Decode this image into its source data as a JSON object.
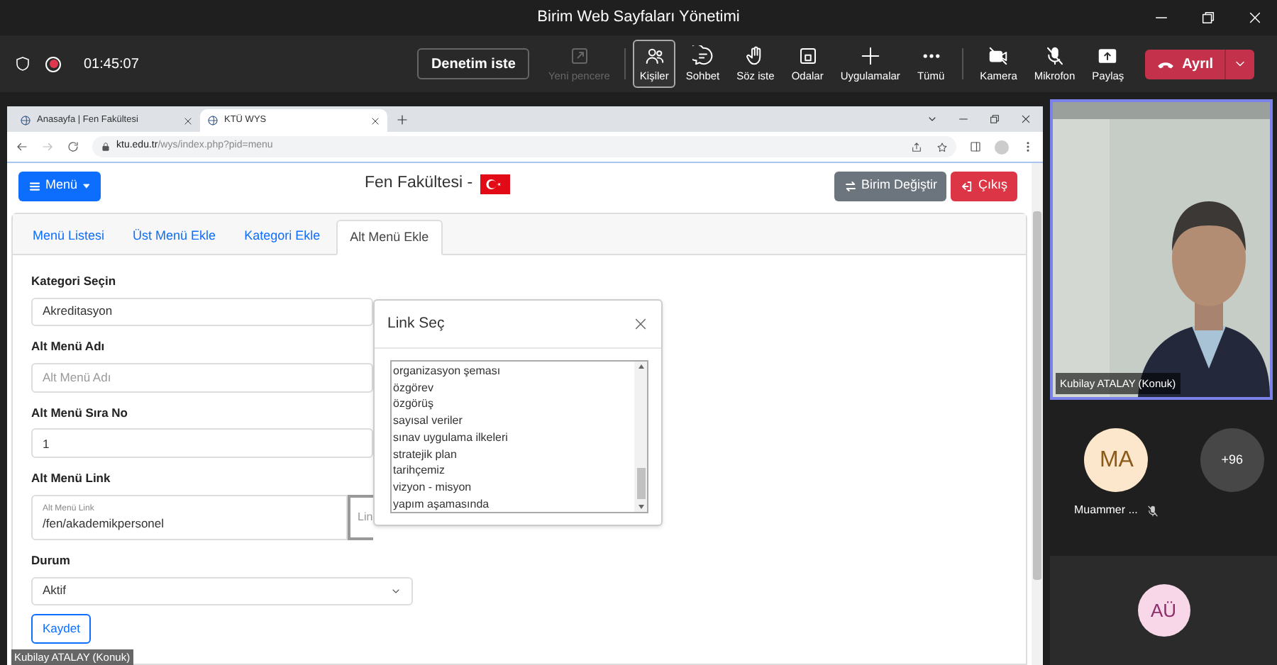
{
  "window": {
    "title": "Birim Web Sayfaları Yönetimi"
  },
  "meeting_bar": {
    "timer": "01:45:07",
    "request_button": "Denetim iste",
    "tools": [
      {
        "kind": "new-window",
        "label": "Yeni pencere",
        "disabled": true,
        "selected": false
      },
      {
        "kind": "people",
        "label": "Kişiler",
        "disabled": false,
        "selected": true
      },
      {
        "kind": "chat",
        "label": "Sohbet",
        "disabled": false,
        "selected": false
      },
      {
        "kind": "hand",
        "label": "Söz iste",
        "disabled": false,
        "selected": false
      },
      {
        "kind": "rooms",
        "label": "Odalar",
        "disabled": false,
        "selected": false
      },
      {
        "kind": "plus",
        "label": "Uygulamalar",
        "disabled": false,
        "selected": false
      },
      {
        "kind": "more",
        "label": "Tümü",
        "disabled": false,
        "selected": false
      }
    ],
    "devices": [
      {
        "kind": "camera-off",
        "label": "Kamera"
      },
      {
        "kind": "mic-off",
        "label": "Mikrofon"
      },
      {
        "kind": "share",
        "label": "Paylaş"
      }
    ],
    "leave_button": "Ayrıl"
  },
  "shared_screen": {
    "presenter_label": "Kubilay ATALAY (Konuk)",
    "browser": {
      "tabs": [
        {
          "label": "Anasayfa | Fen Fakültesi",
          "selected": false
        },
        {
          "label": "KTÜ WYS",
          "selected": true
        }
      ],
      "url_host": "ktu.edu.tr",
      "url_path": "/wys/index.php?pid=menu"
    },
    "page": {
      "menu_button": "Menü",
      "site_title": "Fen Fakültesi -",
      "switch_button": "Birim Değiştir",
      "logout_button": "Çıkış",
      "tabs": [
        {
          "label": "Menü Listesi",
          "selected": false
        },
        {
          "label": "Üst Menü Ekle",
          "selected": false
        },
        {
          "label": "Kategori Ekle",
          "selected": false
        },
        {
          "label": "Alt Menü Ekle",
          "selected": true
        }
      ],
      "fields": [
        {
          "kind": "plain-select",
          "label": "Kategori Seçin",
          "value": "Akreditasyon"
        },
        {
          "kind": "input",
          "label": "Alt Menü Adı",
          "placeholder": "Alt Menü Adı"
        },
        {
          "kind": "input",
          "label": "Alt Menü Sıra No",
          "value": "1"
        },
        {
          "kind": "link-input",
          "label": "Alt Menü Link",
          "floating_label": "Alt Menü Link",
          "value": "/fen/akademikpersonel",
          "button": "Lin"
        },
        {
          "kind": "select",
          "label": "Durum",
          "value": "Aktif"
        }
      ],
      "save_button": "Kaydet",
      "modal": {
        "title": "Link Seç",
        "options": [
          "organizasyon şeması",
          "özgörev",
          "özgörüş",
          "sayısal veriler",
          "sınav uygulama ilkeleri",
          "stratejik plan",
          "tarihçemiz",
          "vizyon - misyon",
          "yapım aşamasında"
        ]
      }
    }
  },
  "participants": {
    "video": {
      "kind": "picture",
      "name": "Kubilay ATALAY (Konuk)"
    },
    "people": [
      {
        "initials": "MA",
        "name": "Muammer ...",
        "color": "#fde7cc",
        "muted": true
      },
      {
        "initials": "AÜ",
        "color": "#f8d7e8",
        "muted": false
      }
    ],
    "overflow_count": "+96"
  }
}
